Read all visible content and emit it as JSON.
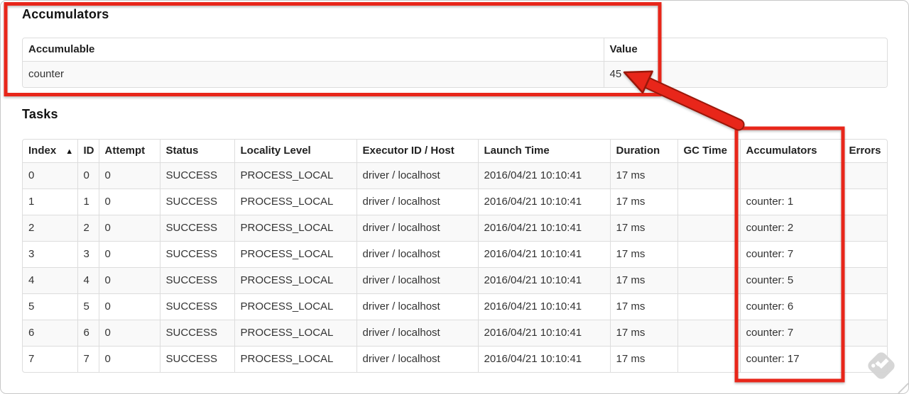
{
  "accumulators_section": {
    "title": "Accumulators",
    "table": {
      "headers": [
        {
          "label": "Accumulable"
        },
        {
          "label": "Value"
        }
      ],
      "rows": [
        [
          "counter",
          "45"
        ]
      ]
    }
  },
  "tasks_section": {
    "title": "Tasks",
    "table": {
      "headers": [
        {
          "label": "Index",
          "sort_icon": "▲"
        },
        {
          "label": "ID"
        },
        {
          "label": "Attempt"
        },
        {
          "label": "Status"
        },
        {
          "label": "Locality Level"
        },
        {
          "label": "Executor ID / Host"
        },
        {
          "label": "Launch Time"
        },
        {
          "label": "Duration"
        },
        {
          "label": "GC Time"
        },
        {
          "label": "Accumulators"
        },
        {
          "label": "Errors"
        }
      ],
      "rows": [
        [
          "0",
          "0",
          "0",
          "SUCCESS",
          "PROCESS_LOCAL",
          "driver / localhost",
          "2016/04/21 10:10:41",
          "17 ms",
          "",
          "",
          ""
        ],
        [
          "1",
          "1",
          "0",
          "SUCCESS",
          "PROCESS_LOCAL",
          "driver / localhost",
          "2016/04/21 10:10:41",
          "17 ms",
          "",
          "counter: 1",
          ""
        ],
        [
          "2",
          "2",
          "0",
          "SUCCESS",
          "PROCESS_LOCAL",
          "driver / localhost",
          "2016/04/21 10:10:41",
          "17 ms",
          "",
          "counter: 2",
          ""
        ],
        [
          "3",
          "3",
          "0",
          "SUCCESS",
          "PROCESS_LOCAL",
          "driver / localhost",
          "2016/04/21 10:10:41",
          "17 ms",
          "",
          "counter: 7",
          ""
        ],
        [
          "4",
          "4",
          "0",
          "SUCCESS",
          "PROCESS_LOCAL",
          "driver / localhost",
          "2016/04/21 10:10:41",
          "17 ms",
          "",
          "counter: 5",
          ""
        ],
        [
          "5",
          "5",
          "0",
          "SUCCESS",
          "PROCESS_LOCAL",
          "driver / localhost",
          "2016/04/21 10:10:41",
          "17 ms",
          "",
          "counter: 6",
          ""
        ],
        [
          "6",
          "6",
          "0",
          "SUCCESS",
          "PROCESS_LOCAL",
          "driver / localhost",
          "2016/04/21 10:10:41",
          "17 ms",
          "",
          "counter: 7",
          ""
        ],
        [
          "7",
          "7",
          "0",
          "SUCCESS",
          "PROCESS_LOCAL",
          "driver / localhost",
          "2016/04/21 10:10:41",
          "17 ms",
          "",
          "counter: 17",
          ""
        ]
      ]
    }
  },
  "annotations": {
    "color": "#e8261a",
    "outline_color": "#9a170a",
    "box_1_target": "accumulators-panel",
    "box_2_target": "tasks-accumulators-column",
    "arrow_points_to": "45"
  },
  "watermark": {
    "icon": "feedly-icon",
    "color": "#d4d4d4"
  }
}
